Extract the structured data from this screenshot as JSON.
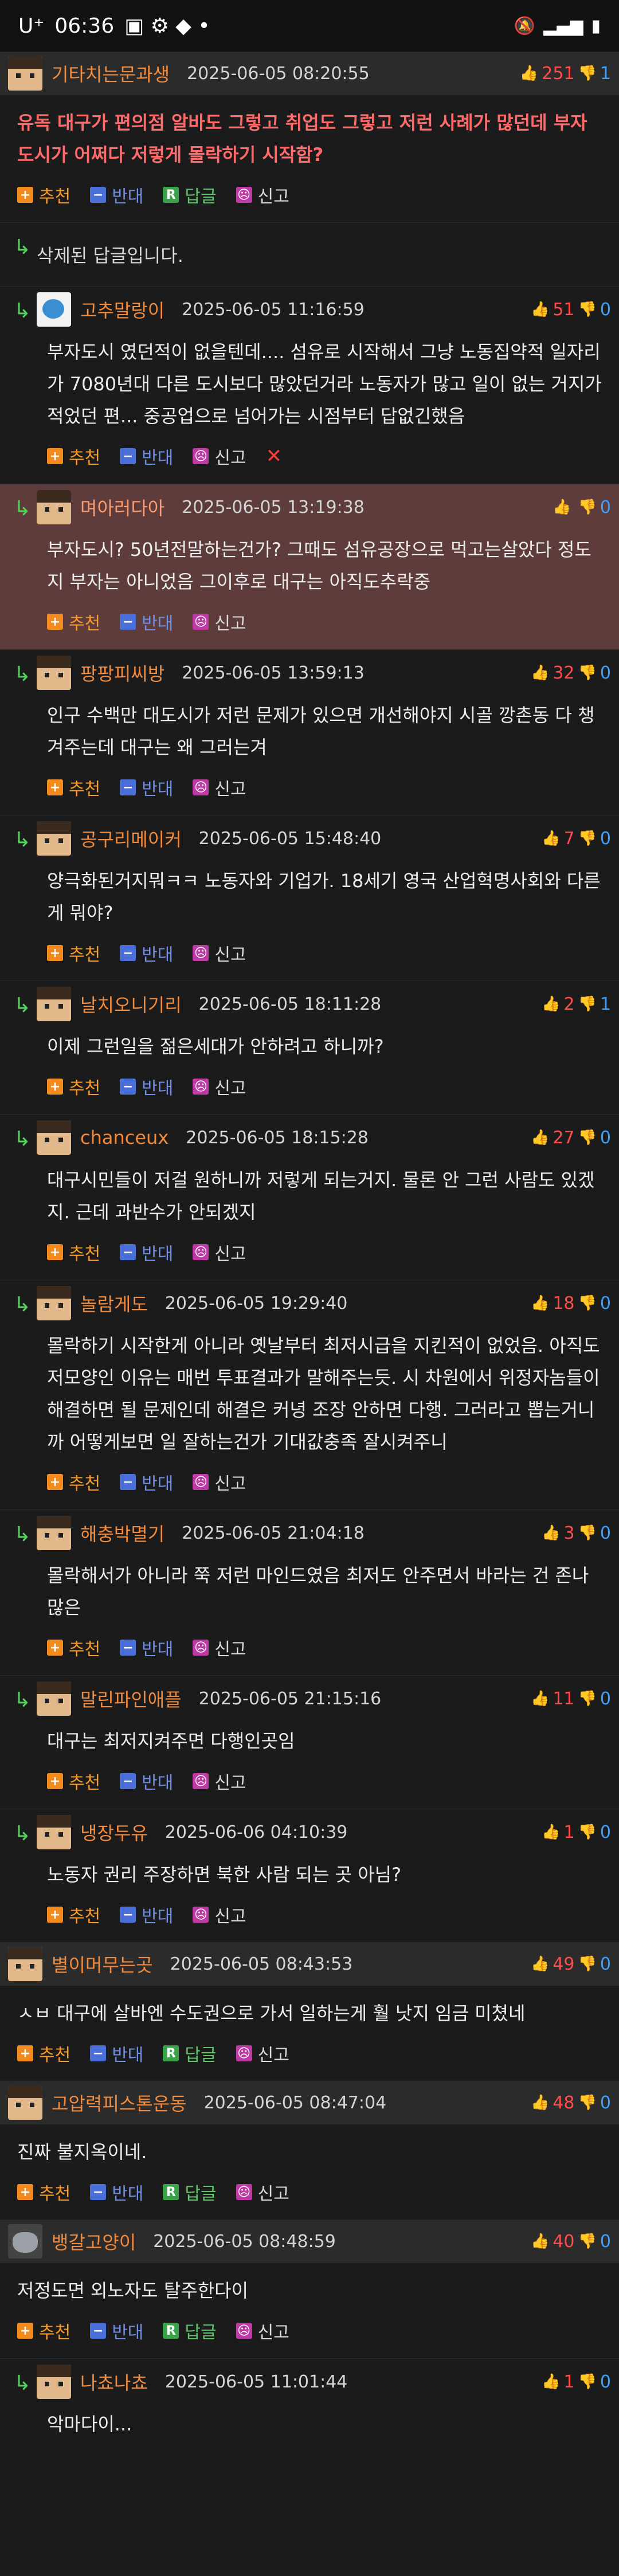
{
  "status": {
    "carrier": "U⁺",
    "time": "06:36",
    "signal_icons": [
      "mute-icon",
      "vowifi-icon",
      "signal-icon",
      "battery-icon"
    ]
  },
  "posts": [
    {
      "type": "post",
      "nick": "기타치는문과생",
      "date": "2025-06-05 08:20:55",
      "up": "251",
      "down": "1",
      "text": "유독 대구가 편의점 알바도 그렇고 취업도 그렇고 저런 사례가 많던데 부자도시가 어쩌다 저렇게 몰락하기 시작함?",
      "bold": true,
      "avatar": "face",
      "replies": [
        {
          "deleted": true,
          "text": "삭제된 답글입니다."
        },
        {
          "nick": "고추말랑이",
          "date": "2025-06-05 11:16:59",
          "up": "51",
          "down": "0",
          "avatar": "bird",
          "text": "부자도시 였던적이 없을텐데.... 섬유로 시작해서 그냥 노동집약적 일자리가 7080년대 다른 도시보다 많았던거라 노동자가 많고 일이 없는 거지가 적었던 편... 중공업으로 넘어가는 시점부터 답없긴했음",
          "delete_btn": true
        },
        {
          "nick": "며아러다아",
          "date": "2025-06-05 13:19:38",
          "up": "",
          "down": "0",
          "avatar": "face",
          "highlight": true,
          "text": "부자도시? 50년전말하는건가? 그때도 섬유공장으로 먹고는살았다 정도지 부자는 아니었음 그이후로 대구는 아직도추락중"
        },
        {
          "nick": "팡팡피씨방",
          "date": "2025-06-05 13:59:13",
          "up": "32",
          "down": "0",
          "avatar": "face",
          "text": "인구 수백만 대도시가 저런 문제가 있으면 개선해야지 시골 깡촌동 다 챙겨주는데 대구는 왜 그러는겨"
        },
        {
          "nick": "공구리메이커",
          "date": "2025-06-05 15:48:40",
          "up": "7",
          "down": "0",
          "avatar": "face",
          "text": "양극화된거지뭐ㅋㅋ 노동자와 기업가. 18세기 영국 산업혁명사회와 다른게 뭐야?"
        },
        {
          "nick": "날치오니기리",
          "date": "2025-06-05 18:11:28",
          "up": "2",
          "down": "1",
          "avatar": "face",
          "text": "이제 그런일을 젊은세대가 안하려고 하니까?"
        },
        {
          "nick": "chanceux",
          "date": "2025-06-05 18:15:28",
          "up": "27",
          "down": "0",
          "avatar": "face",
          "text": "대구시민들이 저걸 원하니까 저렇게 되는거지. 물론 안 그런 사람도 있겠지. 근데 과반수가 안되겠지"
        },
        {
          "nick": "놀람게도",
          "date": "2025-06-05 19:29:40",
          "up": "18",
          "down": "0",
          "avatar": "face",
          "text": "몰락하기 시작한게 아니라 옛날부터 최저시급을 지킨적이 없었음. 아직도 저모양인 이유는 매번 투표결과가 말해주는듯. 시 차원에서 위정자놈들이 해결하면 될 문제인데 해결은 커녕 조장 안하면 다행. 그러라고 뽑는거니까 어떻게보면 일 잘하는건가 기대값충족 잘시켜주니"
        },
        {
          "nick": "해충박멸기",
          "date": "2025-06-05 21:04:18",
          "up": "3",
          "down": "0",
          "avatar": "face",
          "text": "몰락해서가 아니라 쭉 저런 마인드였음 최저도 안주면서 바라는 건 존나많은"
        },
        {
          "nick": "말린파인애플",
          "date": "2025-06-05 21:15:16",
          "up": "11",
          "down": "0",
          "avatar": "face",
          "text": "대구는 최저지켜주면 다행인곳임"
        },
        {
          "nick": "냉장두유",
          "date": "2025-06-06 04:10:39",
          "up": "1",
          "down": "0",
          "avatar": "face",
          "text": "노동자 권리 주장하면 북한 사람 되는 곳 아님?"
        }
      ]
    },
    {
      "type": "post",
      "nick": "별이머무는곳",
      "date": "2025-06-05 08:43:53",
      "up": "49",
      "down": "0",
      "avatar": "face",
      "text": "ㅅㅂ 대구에 살바엔 수도권으로 가서 일하는게 훨 낫지 임금 미쳤네",
      "replies": []
    },
    {
      "type": "post",
      "nick": "고압력피스톤운동",
      "date": "2025-06-05 08:47:04",
      "up": "48",
      "down": "0",
      "avatar": "face",
      "text": "진짜 불지옥이네.",
      "replies": []
    },
    {
      "type": "post",
      "nick": "뱅갈고양이",
      "date": "2025-06-05 08:48:59",
      "up": "40",
      "down": "0",
      "avatar": "cat",
      "text": "저정도면 외노자도 탈주한다이",
      "replies": [
        {
          "nick": "나쵸나쵸",
          "date": "2025-06-05 11:01:44",
          "up": "1",
          "down": "0",
          "avatar": "face",
          "text": "악마다이...",
          "no_actions": true
        }
      ]
    }
  ],
  "labels": {
    "recommend": "추천",
    "oppose": "반대",
    "reply": "답글",
    "report": "신고",
    "reply_letter": "R"
  },
  "colors": {
    "background": "#1b1b1b",
    "post_header": "#2b2b2b",
    "nickname": "#f08a3c",
    "upvote": "#ff4d4d",
    "downvote": "#3aa0ff",
    "highlight": "#5e3c3c"
  }
}
